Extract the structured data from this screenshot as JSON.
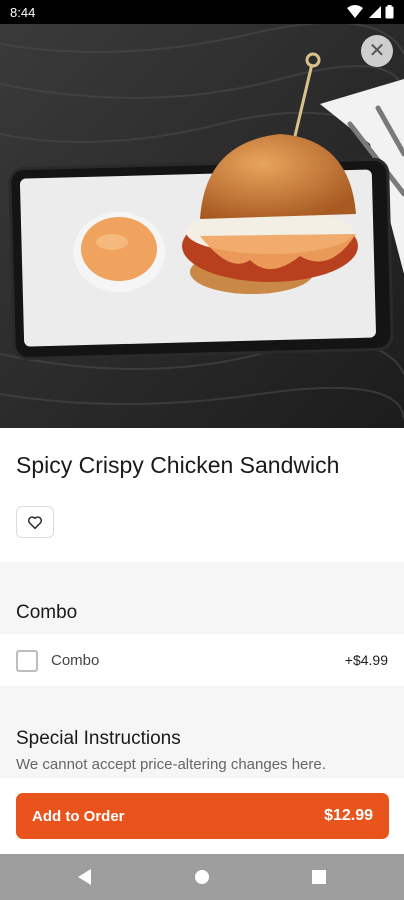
{
  "status_bar": {
    "time": "8:44",
    "icons": [
      "wifi-icon",
      "signal-icon",
      "battery-icon"
    ]
  },
  "product": {
    "image": "spicy-crispy-chicken-sandwich-photo",
    "name": "Spicy Crispy Chicken Sandwich"
  },
  "sections": {
    "combo": {
      "title": "Combo",
      "options": [
        {
          "label": "Combo",
          "price": "+$4.99",
          "checked": false
        }
      ]
    },
    "special_instructions": {
      "title": "Special Instructions",
      "note": "We cannot accept price-altering changes here."
    }
  },
  "footer": {
    "add_label": "Add to Order",
    "price": "$12.99"
  },
  "colors": {
    "accent": "#e8541c"
  },
  "nav": {
    "icons": [
      "back-icon",
      "home-icon",
      "recents-icon"
    ]
  }
}
